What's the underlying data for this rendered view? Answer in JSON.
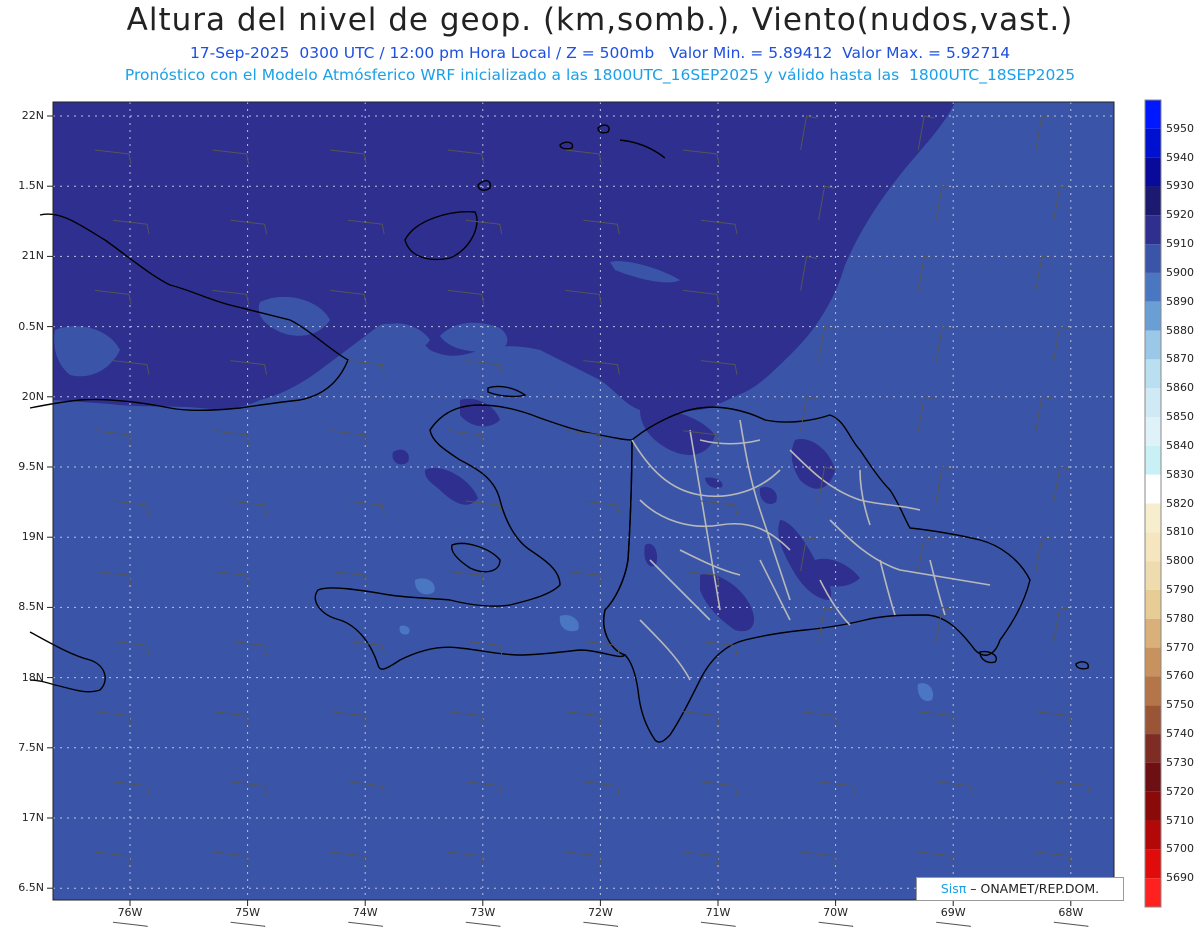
{
  "header": {
    "title": "Altura del nivel de geop. (km,somb.), Viento(nudos,vast.)",
    "line1": "17-Sep-2025  0300 UTC / 12:00 pm Hora Local / Z = 500mb   Valor Min. = 5.89412  Valor Max. = 5.92714",
    "line2": "Pronóstico con el Modelo Atmósferico WRF inicializado a las 1800UTC_16SEP2025 y válido hasta las  1800UTC_18SEP2025"
  },
  "map": {
    "lat_labels": [
      "22N",
      "1.5N",
      "21N",
      "0.5N",
      "20N",
      "9.5N",
      "19N",
      "8.5N",
      "18N",
      "7.5N",
      "17N",
      "6.5N"
    ],
    "lon_labels": [
      "76W",
      "75W",
      "74W",
      "73W",
      "72W",
      "71W",
      "70W",
      "69W",
      "68W"
    ],
    "fill_colors": {
      "5900": "#3a55a8",
      "5910": "#2e2f8e",
      "5890": "#4a76c2"
    }
  },
  "colorbar": {
    "levels": [
      "5950",
      "5940",
      "5930",
      "5920",
      "5910",
      "5900",
      "5890",
      "5880",
      "5870",
      "5860",
      "5850",
      "5840",
      "5830",
      "5820",
      "5810",
      "5800",
      "5790",
      "5780",
      "5770",
      "5760",
      "5750",
      "5740",
      "5730",
      "5720",
      "5710",
      "5700",
      "5690"
    ],
    "colors": [
      "#0018ff",
      "#0010d0",
      "#0a0a9a",
      "#1b1a70",
      "#2e2f8e",
      "#3a55a8",
      "#4a76c2",
      "#6a9fd6",
      "#9ac8e6",
      "#b9dff0",
      "#cfe9f5",
      "#dff2f8",
      "#c8f0f5",
      "#ffffff",
      "#f7eecd",
      "#f5e6bf",
      "#efdcae",
      "#e8cc96",
      "#d9b07a",
      "#c7925e",
      "#b47548",
      "#9a5436",
      "#7f2c24",
      "#6e0f14",
      "#8a0a0a",
      "#b30808",
      "#e00c0c",
      "#ff2020"
    ]
  },
  "credit": {
    "brand": "Sisπ",
    "text": " – ONAMET/REP.DOM."
  }
}
